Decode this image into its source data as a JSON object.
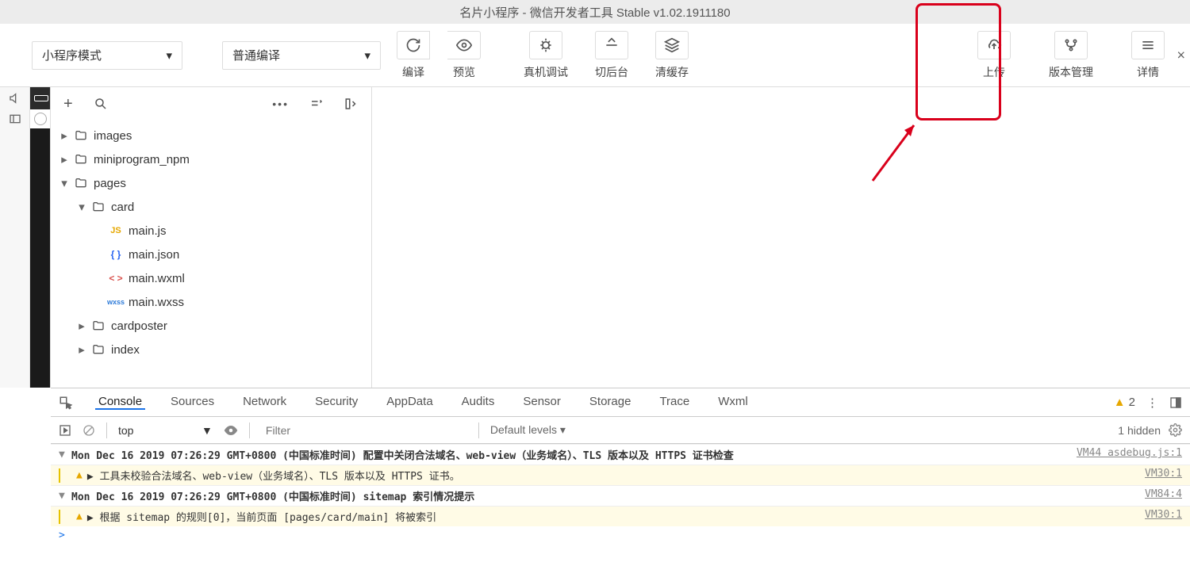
{
  "title": "名片小程序 - 微信开发者工具 Stable v1.02.1911180",
  "toolbar": {
    "mode": "小程序模式",
    "compile": "普通编译",
    "buttons": {
      "compile": "编译",
      "preview": "预览",
      "debug": "真机调试",
      "background": "切后台",
      "clearCache": "清缓存",
      "upload": "上传",
      "version": "版本管理",
      "details": "详情"
    }
  },
  "tree": {
    "items": [
      {
        "name": "images",
        "type": "folder",
        "level": 0,
        "expanded": false
      },
      {
        "name": "miniprogram_npm",
        "type": "folder",
        "level": 0,
        "expanded": false
      },
      {
        "name": "pages",
        "type": "folder",
        "level": 0,
        "expanded": true
      },
      {
        "name": "card",
        "type": "folder",
        "level": 1,
        "expanded": true
      },
      {
        "name": "main.js",
        "type": "fjs",
        "level": 2
      },
      {
        "name": "main.json",
        "type": "fjson",
        "level": 2
      },
      {
        "name": "main.wxml",
        "type": "fwxml",
        "level": 2
      },
      {
        "name": "main.wxss",
        "type": "fwxss",
        "level": 2
      },
      {
        "name": "cardposter",
        "type": "folder",
        "level": 1,
        "expanded": false
      },
      {
        "name": "index",
        "type": "folder",
        "level": 1,
        "expanded": false
      }
    ]
  },
  "devtools": {
    "tabs": [
      "Console",
      "Sources",
      "Network",
      "Security",
      "AppData",
      "Audits",
      "Sensor",
      "Storage",
      "Trace",
      "Wxml"
    ],
    "activeTab": "Console",
    "warnCount": "2",
    "filter": {
      "top": "top",
      "placeholder": "Filter",
      "levels": "Default levels ▾",
      "hidden": "1 hidden"
    },
    "rows": [
      {
        "kind": "group",
        "msg": "Mon Dec 16 2019 07:26:29 GMT+0800 (中国标准时间) 配置中关闭合法域名、web-view（业务域名）、TLS 版本以及 HTTPS 证书检查",
        "src": "VM44 asdebug.js:1"
      },
      {
        "kind": "warn",
        "msg": "▶ 工具未校验合法域名、web-view（业务域名）、TLS 版本以及 HTTPS 证书。",
        "src": "VM30:1"
      },
      {
        "kind": "group",
        "msg": "Mon Dec 16 2019 07:26:29 GMT+0800 (中国标准时间) sitemap 索引情况提示",
        "src": "VM84:4"
      },
      {
        "kind": "warn",
        "msg": "▶ 根据 sitemap 的规则[0]，当前页面 [pages/card/main] 将被索引",
        "src": "VM30:1"
      }
    ]
  }
}
